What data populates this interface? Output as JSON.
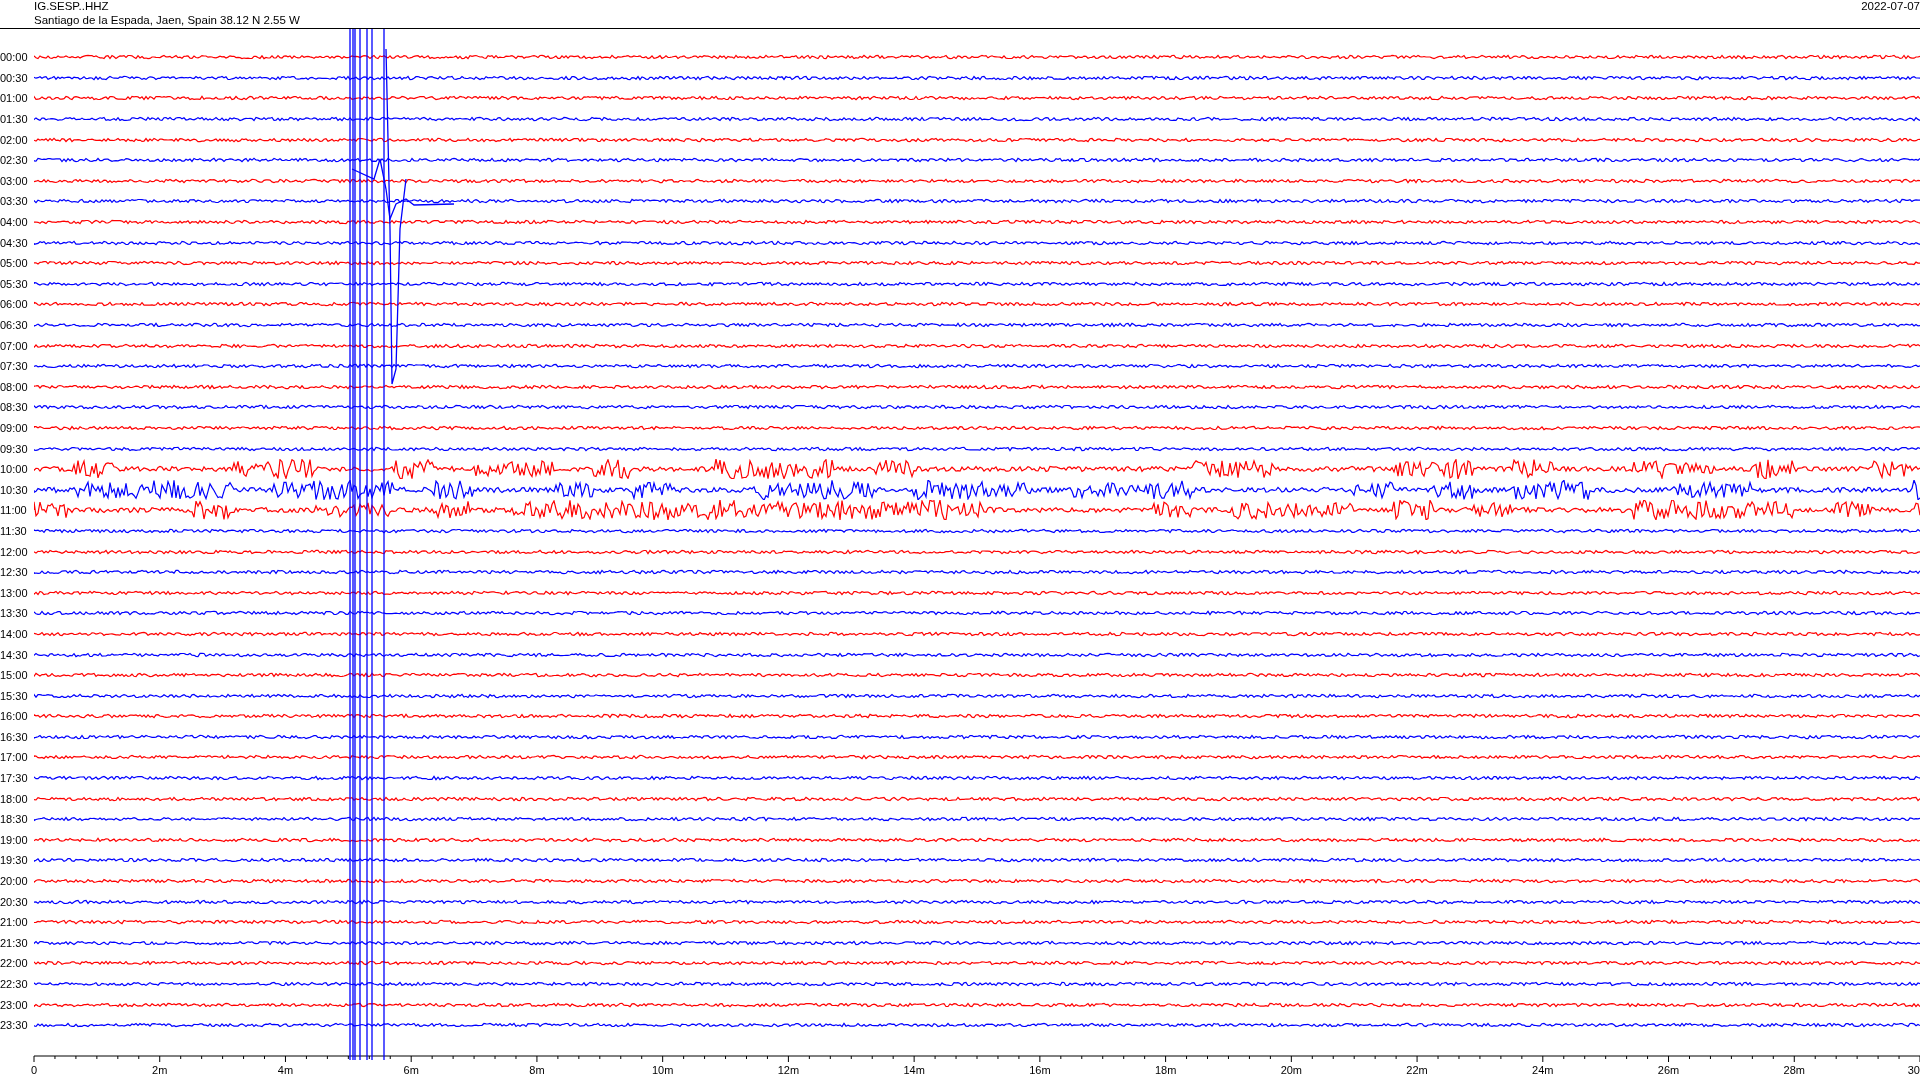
{
  "header": {
    "station": "IG.SESP..HHZ",
    "location": "Santiago de la Espada, Jaen, Spain  38.12 N 2.55 W",
    "date": "2022-07-07"
  },
  "rows": [
    {
      "label": "00:00",
      "color": "#ff0000"
    },
    {
      "label": "00:30",
      "color": "#0000ff"
    },
    {
      "label": "01:00",
      "color": "#ff0000"
    },
    {
      "label": "01:30",
      "color": "#0000ff"
    },
    {
      "label": "02:00",
      "color": "#ff0000"
    },
    {
      "label": "02:30",
      "color": "#0000ff"
    },
    {
      "label": "03:00",
      "color": "#ff0000"
    },
    {
      "label": "03:30",
      "color": "#0000ff"
    },
    {
      "label": "04:00",
      "color": "#ff0000"
    },
    {
      "label": "04:30",
      "color": "#0000ff"
    },
    {
      "label": "05:00",
      "color": "#ff0000"
    },
    {
      "label": "05:30",
      "color": "#0000ff"
    },
    {
      "label": "06:00",
      "color": "#ff0000"
    },
    {
      "label": "06:30",
      "color": "#0000ff"
    },
    {
      "label": "07:00",
      "color": "#ff0000"
    },
    {
      "label": "07:30",
      "color": "#0000ff"
    },
    {
      "label": "08:00",
      "color": "#ff0000"
    },
    {
      "label": "08:30",
      "color": "#0000ff"
    },
    {
      "label": "09:00",
      "color": "#ff0000"
    },
    {
      "label": "09:30",
      "color": "#0000ff"
    },
    {
      "label": "10:00",
      "color": "#ff0000"
    },
    {
      "label": "10:30",
      "color": "#0000ff"
    },
    {
      "label": "11:00",
      "color": "#ff0000"
    },
    {
      "label": "11:30",
      "color": "#0000ff"
    },
    {
      "label": "12:00",
      "color": "#ff0000"
    },
    {
      "label": "12:30",
      "color": "#0000ff"
    },
    {
      "label": "13:00",
      "color": "#ff0000"
    },
    {
      "label": "13:30",
      "color": "#0000ff"
    },
    {
      "label": "14:00",
      "color": "#ff0000"
    },
    {
      "label": "14:30",
      "color": "#0000ff"
    },
    {
      "label": "15:00",
      "color": "#ff0000"
    },
    {
      "label": "15:30",
      "color": "#0000ff"
    },
    {
      "label": "16:00",
      "color": "#ff0000"
    },
    {
      "label": "16:30",
      "color": "#0000ff"
    },
    {
      "label": "17:00",
      "color": "#ff0000"
    },
    {
      "label": "17:30",
      "color": "#0000ff"
    },
    {
      "label": "18:00",
      "color": "#ff0000"
    },
    {
      "label": "18:30",
      "color": "#0000ff"
    },
    {
      "label": "19:00",
      "color": "#ff0000"
    },
    {
      "label": "19:30",
      "color": "#0000ff"
    },
    {
      "label": "20:00",
      "color": "#ff0000"
    },
    {
      "label": "20:30",
      "color": "#0000ff"
    },
    {
      "label": "21:00",
      "color": "#ff0000"
    },
    {
      "label": "21:30",
      "color": "#0000ff"
    },
    {
      "label": "22:00",
      "color": "#ff0000"
    },
    {
      "label": "22:30",
      "color": "#0000ff"
    },
    {
      "label": "23:00",
      "color": "#ff0000"
    },
    {
      "label": "23:30",
      "color": "#0000ff"
    }
  ],
  "x_axis": {
    "labels": [
      "0",
      "2m",
      "4m",
      "6m",
      "8m",
      "10m",
      "12m",
      "14m",
      "16m",
      "18m",
      "20m",
      "22m",
      "24m",
      "26m",
      "28m",
      "30"
    ]
  }
}
